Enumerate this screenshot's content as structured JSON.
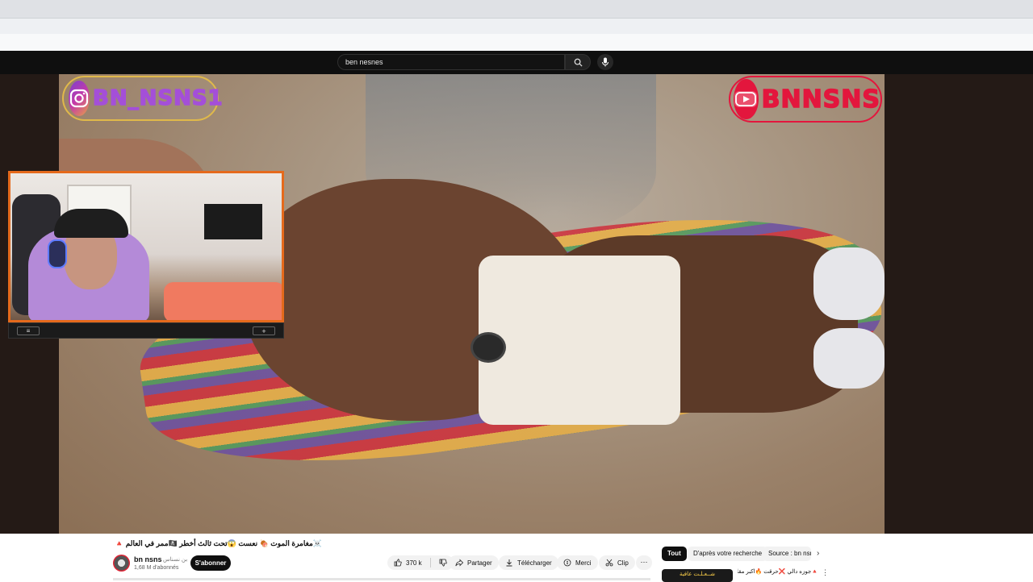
{
  "search": {
    "query": "ben nesnes"
  },
  "overlay": {
    "instagram_handle": "BN_NSNS1",
    "youtube_handle": "BNNSNS"
  },
  "cam_bar": {
    "left_badge": "≡",
    "right_badge": "+"
  },
  "video": {
    "title": "☠️مغامرة الموت 🍖 نعست 😱تحت ثالث أخطر 🏴‍☠️ممر في العالم 🔺",
    "channel_name": "bn nsns",
    "channel_name_ar": "بن نسناس",
    "subscribers": "1,68 M d'abonnés",
    "subscribe_label": "S'abonner",
    "likes": "370 k",
    "share_label": "Partager",
    "download_label": "Télécharger",
    "thanks_label": "Merci",
    "clip_label": "Clip",
    "more_label": "···"
  },
  "chips": [
    {
      "label": "Tout",
      "active": true
    },
    {
      "label": "D'après votre recherche",
      "active": false
    },
    {
      "label": "Source : bn nsns",
      "active": false
    }
  ],
  "recommendation": {
    "thumb_text": "شــعـلـت عافية",
    "title": "🔺جوزه دالي ❌حرقت 🔥اكبر مقلب"
  },
  "colors": {
    "accent_orange": "#e56a1c",
    "instagram_purple": "#a44fd8",
    "youtube_red": "#e3163d",
    "header_dark": "#0f0f0f"
  }
}
